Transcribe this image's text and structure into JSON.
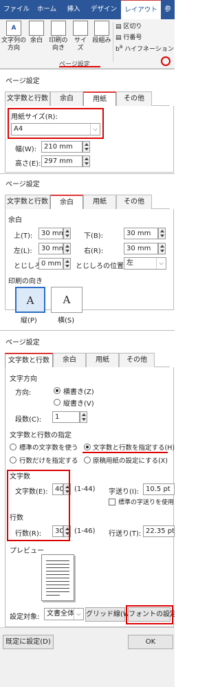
{
  "ribbon": {
    "tabs": [
      "ファイル",
      "ホーム",
      "挿入",
      "デザイン",
      "レイアウト",
      "参"
    ],
    "buttons": {
      "text_dir": "文字列の",
      "text_dir2": "方向",
      "margins": "余白",
      "orientation": "印刷の",
      "orientation2": "向き",
      "size": "サイズ",
      "columns": "段組み"
    },
    "side": {
      "breaks": "区切り",
      "line_numbers": "行番号",
      "hyphenation": "ハイフネーション"
    },
    "group_label": "ページ設定"
  },
  "dlg1": {
    "title": "ページ設定",
    "tabs": [
      "文字数と行数",
      "余白",
      "用紙",
      "その他"
    ],
    "paper_size_label": "用紙サイズ(R):",
    "paper_size": "A4",
    "width_label": "幅(W):",
    "width": "210 mm",
    "height_label": "高さ(E):",
    "height": "297 mm"
  },
  "dlg2": {
    "title": "ページ設定",
    "tabs": [
      "文字数と行数",
      "余白",
      "用紙",
      "その他"
    ],
    "margin_section": "余白",
    "top_label": "上(T):",
    "top": "30 mm",
    "bottom_label": "下(B):",
    "bottom": "30 mm",
    "left_label": "左(L):",
    "left": "30 mm",
    "right_label": "右(R):",
    "right": "30 mm",
    "gutter_label": "とじしろ",
    "gutter": "0 mm",
    "gutter_pos_label": "とじしろの位置",
    "gutter_pos": "左",
    "orientation_section": "印刷の向き",
    "portrait": "縦(P)",
    "landscape": "横(S)",
    "glyph": "A"
  },
  "dlg3": {
    "title": "ページ設定",
    "tabs": [
      "文字数と行数",
      "余白",
      "用紙",
      "その他"
    ],
    "dir_section": "文字方向",
    "dir_label": "方向:",
    "horizontal": "横書き(Z)",
    "vertical": "縦書き(V)",
    "cols_label": "段数(C):",
    "cols": "1",
    "spec_section": "文字数と行数の指定",
    "opt_standard": "標準の文字数を使う",
    "opt_both": "文字数と行数を指定する(H)",
    "opt_lines": "行数だけを指定する",
    "opt_grid": "原稿用紙の設定にする(X)",
    "chars_section": "文字数",
    "chars_label": "文字数(E):",
    "chars": "40",
    "chars_range": "(1-44)",
    "char_pitch_label": "字送り(I):",
    "char_pitch": "10.5 pt",
    "std_pitch": "標準の字送りを使用す",
    "lines_section": "行数",
    "lines_label": "行数(R):",
    "lines": "30",
    "lines_range": "(1-46)",
    "line_pitch_label": "行送り(T):",
    "line_pitch": "22.35 pt",
    "preview_section": "プレビュー",
    "apply_label": "設定対象:",
    "apply": "文書全体",
    "grid_button": "グリッド線(W)",
    "font_button": "フォントの設定",
    "default_button": "既定に設定(D)",
    "ok": "OK"
  }
}
